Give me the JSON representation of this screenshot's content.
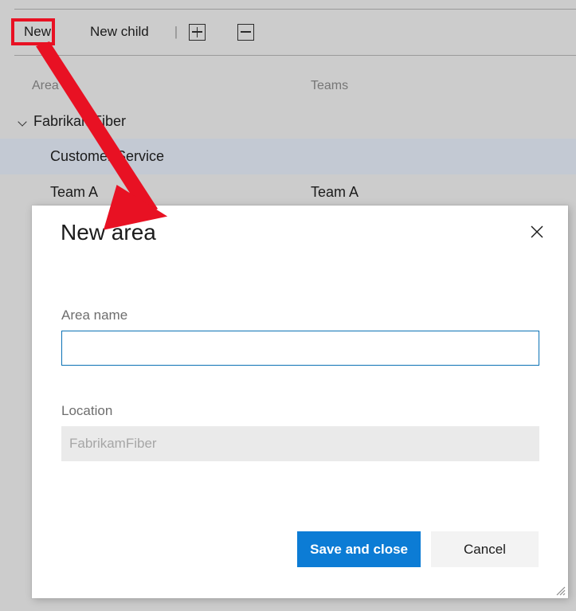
{
  "toolbar": {
    "new_label": "New",
    "new_child_label": "New child",
    "separator": "|",
    "expand_all_icon": "plus-box-icon",
    "collapse_all_icon": "minus-box-icon"
  },
  "grid": {
    "columns": [
      "Area",
      "Teams"
    ],
    "rows": [
      {
        "area": "FabrikamFiber",
        "teams": "",
        "indent": 0,
        "expanded": true,
        "selected": false
      },
      {
        "area": "Customer Service",
        "teams": "",
        "indent": 1,
        "expanded": false,
        "selected": true
      },
      {
        "area": "Team A",
        "teams": "Team A",
        "indent": 1,
        "expanded": false,
        "selected": false
      }
    ]
  },
  "annotation": {
    "highlight_target": "New",
    "arrow_color": "#e81123",
    "highlight_color": "#e81123"
  },
  "dialog": {
    "title": "New area",
    "close_icon": "close-icon",
    "fields": {
      "area_name": {
        "label": "Area name",
        "value": "",
        "placeholder": ""
      },
      "location": {
        "label": "Location",
        "value": "FabrikamFiber",
        "readonly": true
      }
    },
    "buttons": {
      "save": "Save and close",
      "cancel": "Cancel"
    },
    "resize_grip_icon": "resize-grip-icon"
  },
  "colors": {
    "page_background": "#cccccc",
    "selected_row": "#c3c9d3",
    "primary_button": "#0c7cd5",
    "secondary_button": "#f3f3f3",
    "input_focus_border": "#0b72b5",
    "readonly_field": "#eaeaea"
  }
}
